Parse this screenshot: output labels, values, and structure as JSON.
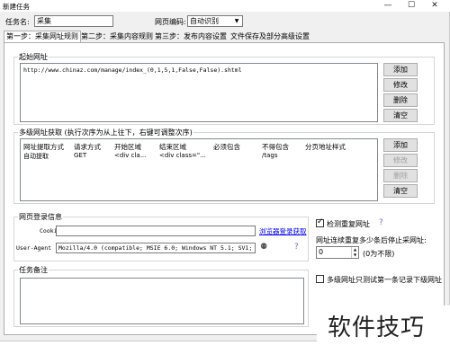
{
  "window": {
    "title": "新建任务"
  },
  "header": {
    "task_name_label": "任务名:",
    "task_name_value": "采集",
    "encoding_label": "网页编码:",
    "encoding_value": "自动识别"
  },
  "tabs": [
    {
      "label": "第一步：采集网址规则"
    },
    {
      "label": "第二步：采集内容规则"
    },
    {
      "label": "第三步：发布内容设置"
    },
    {
      "label": "文件保存及部分高级设置"
    }
  ],
  "start_url": {
    "title": "起始网址",
    "url": "http://www.chinaz.com/manage/index_(0,1,5,1,False,False).shtml",
    "buttons": {
      "add": "添加",
      "edit": "修改",
      "delete": "删除",
      "clear": "清空"
    }
  },
  "multi_url": {
    "title": "多级网址获取 (执行次序为从上往下，右键可调整次序)",
    "columns": [
      "网址提取方式",
      "请求方式",
      "开始区域",
      "结束区域",
      "必须包含",
      "不得包含",
      "分页地址样式"
    ],
    "rows": [
      [
        "自动提取",
        "GET",
        "<div cla...",
        "<div class=\"...",
        "",
        "/tags",
        ""
      ]
    ],
    "buttons": {
      "add": "添加",
      "edit": "修改",
      "delete": "删除",
      "clear": "清空"
    }
  },
  "login": {
    "title": "网页登录信息",
    "cookie_label": "Cookie",
    "cookie_value": "",
    "browser_login_link": "浏览器登录获取",
    "ua_label": "User-Agent",
    "ua_value": "Mozilla/4.0 (compatible; MSIE 6.0; Windows NT 5.1; SV1;"
  },
  "options": {
    "check_duplicate_label": "检测重复网址",
    "check_duplicate": true,
    "stop_after_label": "网址连续重复多少条后停止采网址:",
    "stop_after_value": "0",
    "stop_after_hint": "(0为不限)",
    "only_first_label": "多级网址只测试第一条记录下级网址",
    "only_first": false
  },
  "notes": {
    "title": "任务备注",
    "value": ""
  },
  "watermark": {
    "text": "软件技巧"
  }
}
